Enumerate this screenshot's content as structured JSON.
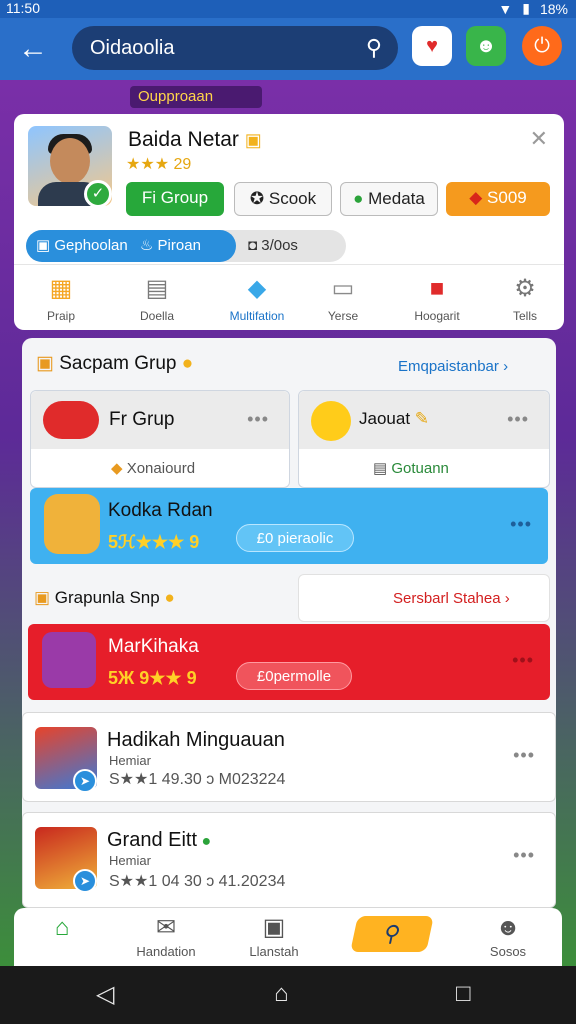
{
  "status": {
    "time": "11:50",
    "battery": "18%"
  },
  "header": {
    "search_value": "Oidaoolia"
  },
  "promo_banner": "Oupproaan",
  "profile": {
    "name": "Baida Netar",
    "rating": "★★★ 29",
    "buttons": {
      "group": "Fi Group",
      "stock": "Scook",
      "media": "Medata",
      "coins": "S009"
    }
  },
  "tabs": {
    "active": "Gephoolan",
    "active_tag": "Piroan",
    "inactive": "3/0os"
  },
  "categories": [
    {
      "label": "Praip",
      "icon": "gift-box-icon"
    },
    {
      "label": "Doella",
      "icon": "stack-icon"
    },
    {
      "label": "Multifation",
      "icon": "gem-icon"
    },
    {
      "label": "Yerse",
      "icon": "crate-icon"
    },
    {
      "label": "Hoogarit",
      "icon": "red-box-icon"
    },
    {
      "label": "Tells",
      "icon": "gear-icon"
    }
  ],
  "section1": {
    "title": "Sacpam Grup",
    "link": "Emqpaistanbar",
    "card_left": {
      "title": "Fr Grup",
      "sub": "Xonaiourd"
    },
    "card_right": {
      "title": "Jaouat",
      "sub": "Gotuann"
    }
  },
  "blue_item": {
    "title": "Kodka Rdan",
    "stars": "5ℋ★★★ 9",
    "pill": "£0 pieraolic"
  },
  "section2": {
    "title": "Grapunla Snp",
    "link": "Sersbarl Stahea"
  },
  "red_item": {
    "title": "MarKihaka",
    "stars": "5Ж 9★★ 9",
    "pill": "£0permolle"
  },
  "list": [
    {
      "title": "Hadikah Minguauan",
      "sub": "Hemiar",
      "meta": "S★★1 49.30 ɔ M023224"
    },
    {
      "title": "Grand Eitt",
      "sub": "Hemiar",
      "meta": "S★★1 04 30 ɔ 41.20234"
    }
  ],
  "bottom_nav": [
    {
      "label": "",
      "icon": "home-icon"
    },
    {
      "label": "Handation",
      "icon": "mail-icon"
    },
    {
      "label": "Llanstah",
      "icon": "folder-icon"
    },
    {
      "label": "",
      "icon": "search-icon"
    },
    {
      "label": "Sosos",
      "icon": "friends-icon"
    }
  ]
}
